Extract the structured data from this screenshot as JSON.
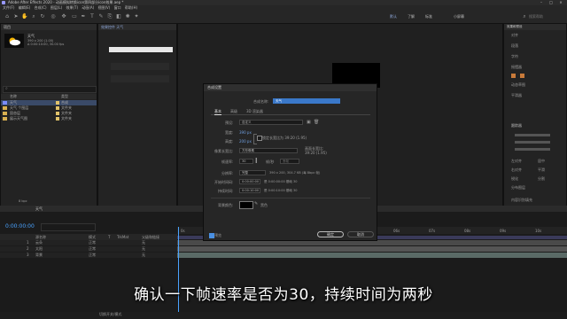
{
  "app": {
    "title": "Adobe After Effects 2020 - 动画模拟转换icon第四部分icon效果.aep *",
    "accent": "#2b8cff"
  },
  "menu": [
    "文件(F)",
    "编辑(E)",
    "合成(C)",
    "图层(L)",
    "效果(T)",
    "动画(A)",
    "视图(V)",
    "窗口",
    "帮助(H)"
  ],
  "toolbar": {
    "workspaces": [
      "默认",
      "了解",
      "标准",
      "小屏幕"
    ],
    "search_placeholder": "搜索帮助"
  },
  "project": {
    "tab": "项目",
    "preview_name": "天气",
    "preview_info1": "390 x 200 (1.00)",
    "preview_info2": "Δ 0:00:10:00, 30.00 fps",
    "col_name": "名称",
    "col_type": "类型",
    "items": [
      {
        "name": "天气",
        "type": "合成",
        "tag": "#e0c26a",
        "selected": true
      },
      {
        "name": "天气 个图层",
        "type": "文件夹",
        "tag": "#e0c26a",
        "selected": false
      },
      {
        "name": "固态层",
        "type": "文件夹",
        "tag": "#e0c26a",
        "selected": false
      },
      {
        "name": "展示天气图",
        "type": "文件夹",
        "tag": "#e0c26a",
        "selected": false
      }
    ],
    "bpc": "8 bpc"
  },
  "effect_controls": {
    "tab": "效果控件 天气"
  },
  "dialog": {
    "title": "合成设置",
    "comp_name_label": "合成名称:",
    "comp_name_value": "天气",
    "tabs": [
      "基本",
      "高级",
      "3D 渲染器"
    ],
    "preset_label": "预设:",
    "preset_value": "自定义",
    "width_label": "宽度:",
    "width_value": "390 px",
    "height_label": "高度:",
    "height_value": "200 px",
    "lock_label": "锁定长宽比为 39:20 (1.95)",
    "pixel_aspect_label": "像素长宽比:",
    "pixel_aspect_value": "方形像素",
    "frame_aspect_label": "画面长宽比:",
    "frame_aspect_value": "39:20 (1.95)",
    "frame_rate_label": "帧速率:",
    "frame_rate_value": "30",
    "frame_rate_unit": "帧/秒",
    "frame_rate_drop": "丢帧",
    "resolution_label": "分辨率:",
    "resolution_value": "完整",
    "resolution_info": "390 x 200, 304.7 KB (每 8bpc 帧)",
    "start_tc_label": "开始时间码:",
    "start_tc_value": "0:00:00:00",
    "start_tc_info": "是 0:00:00:00 基础 30",
    "duration_label": "持续时间:",
    "duration_value": "0:00:10:00",
    "duration_info": "是 0:00:10:00 基础 30",
    "bg_label": "背景颜色:",
    "bg_color_name": "黑色",
    "preview_label": "预览",
    "ok": "确定",
    "cancel": "取消"
  },
  "effects_panel": {
    "tab": "效果和预设",
    "items": [
      "对齐",
      "段落",
      "字符",
      "摇摆器",
      "动态草图",
      "平滑器",
      "跟踪器",
      "内容识别填充"
    ],
    "align_items": [
      "左对齐",
      "居中",
      "右对齐",
      "平滑",
      "锐化",
      "分割",
      "分布图层"
    ]
  },
  "timeline": {
    "comp_tab": "天气",
    "timecode": "0:00:00:00",
    "cols": [
      "源名称",
      "模式",
      "T",
      "TrkMat",
      "父级和链接"
    ],
    "layers": [
      {
        "num": "1",
        "name": "云朵",
        "mode": "正常",
        "parent": "无"
      },
      {
        "num": "2",
        "name": "太阳",
        "mode": "正常",
        "parent": "无"
      },
      {
        "num": "3",
        "name": "背景",
        "mode": "正常",
        "parent": "无"
      }
    ],
    "ruler": [
      "0s",
      "01s",
      "02s",
      "03s",
      "04s",
      "05s",
      "06s",
      "07s",
      "08s",
      "09s",
      "10s"
    ],
    "bottom_label": "切换开关/模式"
  },
  "subtitle": "确认一下帧速率是否为30，持续时间为两秒"
}
